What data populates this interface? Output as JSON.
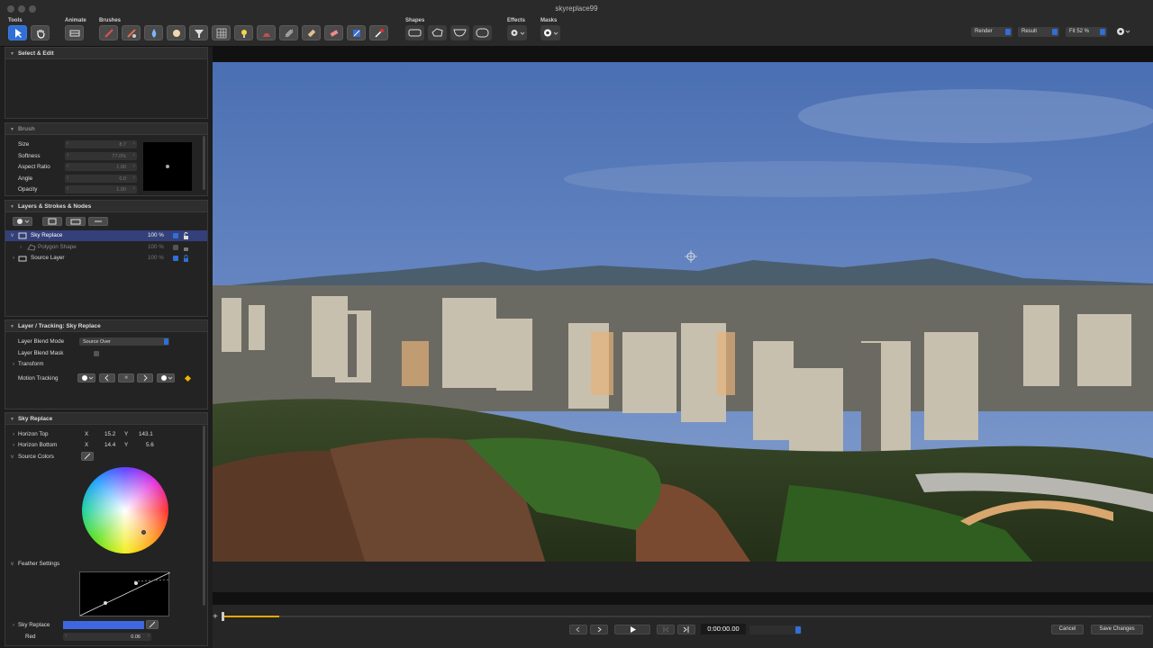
{
  "window": {
    "title": "skyreplace99"
  },
  "toolbar": {
    "tools_label": "Tools",
    "animate_label": "Animate",
    "brushes_label": "Brushes",
    "shapes_label": "Shapes",
    "effects_label": "Effects",
    "masks_label": "Masks",
    "render_select": "Render",
    "result_select": "Result",
    "fit_select": "Fit 52 %",
    "accent_color": "#2f6fd6"
  },
  "select_edit": {
    "title": "Select & Edit"
  },
  "brush": {
    "title": "Brush",
    "params": [
      {
        "label": "Size",
        "value": "8.7"
      },
      {
        "label": "Softness",
        "value": "77.0%"
      },
      {
        "label": "Aspect Ratio",
        "value": "1.00"
      },
      {
        "label": "Angle",
        "value": "0.0"
      },
      {
        "label": "Opacity",
        "value": "1.00"
      }
    ]
  },
  "layers": {
    "title": "Layers & Strokes & Nodes",
    "items": [
      {
        "name": "Sky Replace",
        "opacity": "100 %"
      },
      {
        "name": "Polygon Shape",
        "opacity": "100 %"
      },
      {
        "name": "Source Layer",
        "opacity": "100 %"
      }
    ]
  },
  "tracking": {
    "title": "Layer / Tracking: Sky Replace",
    "blend_mode_label": "Layer Blend Mode",
    "blend_mode_value": "Source Over",
    "blend_mask_label": "Layer Blend Mask",
    "transform_label": "Transform",
    "motion_tracking_label": "Motion Tracking",
    "stop_glyph": "■"
  },
  "sky": {
    "title": "Sky Replace",
    "horizon_top_label": "Horizon Top",
    "horizon_top_x": "15.2",
    "horizon_top_y": "143.1",
    "horizon_bottom_label": "Horizon Bottom",
    "horizon_bottom_x": "14.4",
    "horizon_bottom_y": "5.6",
    "x_label": "X",
    "y_label": "Y",
    "source_colors_label": "Source Colors",
    "feather_label": "Feather Settings",
    "sky_replace_label": "Sky Replace",
    "red_label": "Red",
    "red_value": "0.06"
  },
  "transport": {
    "timecode": "0:00:00.00",
    "cancel_label": "Cancel",
    "save_label": "Save Changes"
  }
}
